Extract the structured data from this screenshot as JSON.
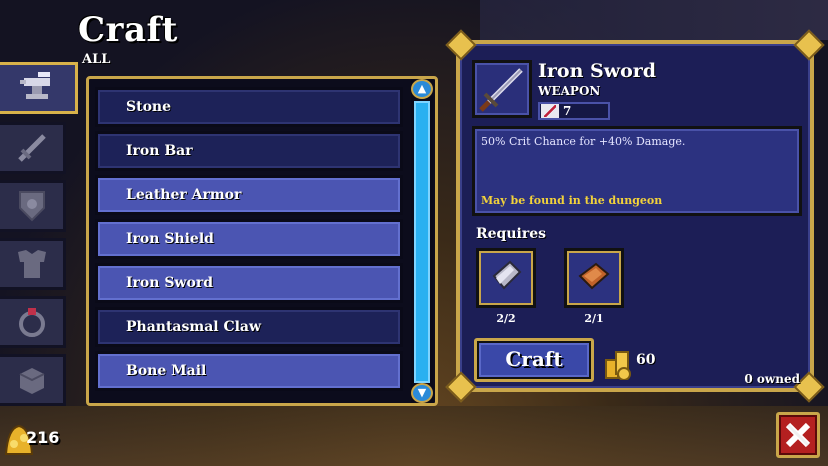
{
  "header": {
    "title": "Craft",
    "filter": "ALL"
  },
  "tabs": [
    {
      "icon": "anvil-icon",
      "active": true
    },
    {
      "icon": "sword-icon",
      "active": false
    },
    {
      "icon": "shield-icon",
      "active": false
    },
    {
      "icon": "armor-icon",
      "active": false
    },
    {
      "icon": "ring-icon",
      "active": false
    },
    {
      "icon": "material-icon",
      "active": false
    }
  ],
  "recipes": [
    {
      "label": "Stone",
      "style": "dark"
    },
    {
      "label": "Iron Bar",
      "style": "dark"
    },
    {
      "label": "Leather Armor",
      "style": "light"
    },
    {
      "label": "Iron Shield",
      "style": "light"
    },
    {
      "label": "Iron Sword",
      "style": "light"
    },
    {
      "label": "Phantasmal Claw",
      "style": "dark"
    },
    {
      "label": "Bone Mail",
      "style": "light"
    }
  ],
  "detail": {
    "name": "Iron Sword",
    "type": "WEAPON",
    "stat_value": "7",
    "description": "50% Crit Chance for +40% Damage.",
    "source": "May be found in the dungeon",
    "requires_label": "Requires",
    "requirements": [
      {
        "icon": "iron-bar-icon",
        "count": "2/2"
      },
      {
        "icon": "leather-icon",
        "count": "2/1"
      }
    ],
    "craft_label": "Craft",
    "cost": "60",
    "owned": "0 owned"
  },
  "gold": "216",
  "colors": {
    "gold": "#c9a64a",
    "panel": "#1c1e56",
    "row_light": "#4b55b2",
    "row_dark": "#1d2258",
    "close": "#b42020"
  }
}
